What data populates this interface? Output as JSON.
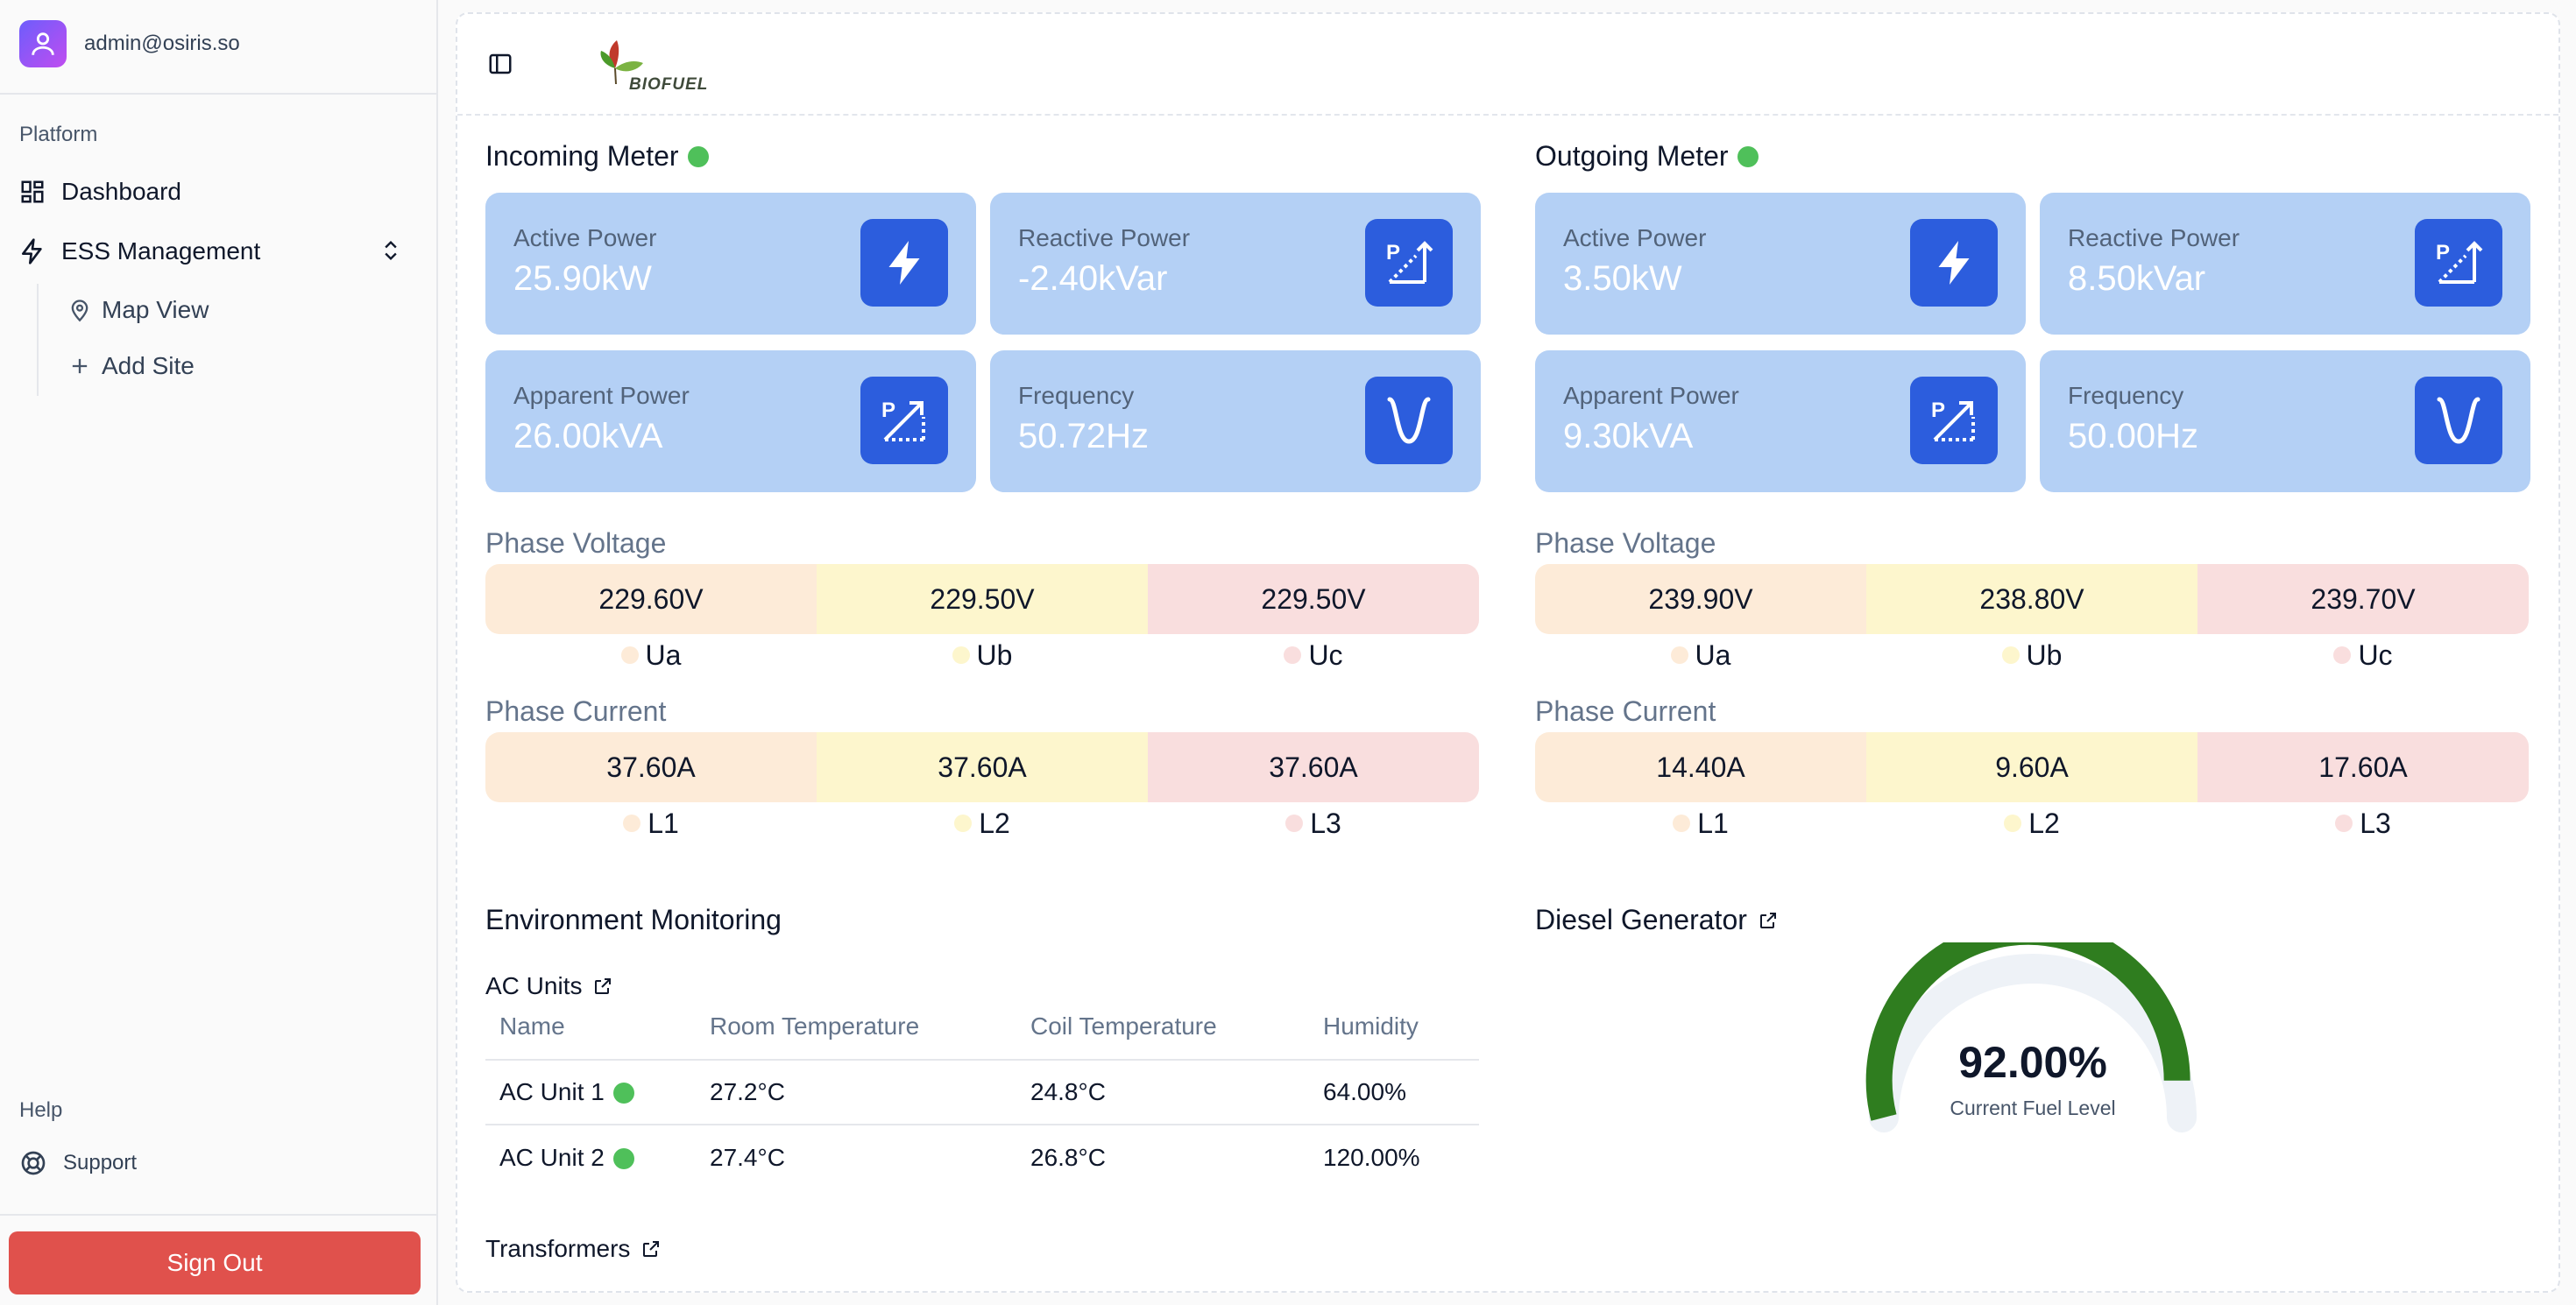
{
  "user": {
    "email": "admin@osiris.so"
  },
  "sidebar": {
    "platform_label": "Platform",
    "items": [
      {
        "label": "Dashboard",
        "icon": "dashboard-icon"
      },
      {
        "label": "ESS Management",
        "icon": "zap-icon"
      }
    ],
    "sub_items": [
      {
        "label": "Map View",
        "icon": "map-pin-icon"
      },
      {
        "label": "Add Site",
        "icon": "plus-icon"
      }
    ],
    "help_label": "Help",
    "support_label": "Support",
    "signout_label": "Sign Out"
  },
  "header": {
    "logo_text": "BIOFUEL"
  },
  "incoming": {
    "title": "Incoming Meter",
    "status_color": "#4fc05a",
    "cards": [
      {
        "label": "Active Power",
        "value": "25.90kW",
        "icon": "lightning-icon"
      },
      {
        "label": "Reactive Power",
        "value": "-2.40kVar",
        "icon": "reactive-power-icon"
      },
      {
        "label": "Apparent Power",
        "value": "26.00kVA",
        "icon": "apparent-power-icon"
      },
      {
        "label": "Frequency",
        "value": "50.72Hz",
        "icon": "frequency-icon"
      }
    ],
    "phase_voltage_title": "Phase Voltage",
    "phase_voltage": [
      {
        "value": "229.60V",
        "label": "Ua"
      },
      {
        "value": "229.50V",
        "label": "Ub"
      },
      {
        "value": "229.50V",
        "label": "Uc"
      }
    ],
    "phase_current_title": "Phase Current",
    "phase_current": [
      {
        "value": "37.60A",
        "label": "L1"
      },
      {
        "value": "37.60A",
        "label": "L2"
      },
      {
        "value": "37.60A",
        "label": "L3"
      }
    ]
  },
  "outgoing": {
    "title": "Outgoing Meter",
    "status_color": "#4fc05a",
    "cards": [
      {
        "label": "Active Power",
        "value": "3.50kW",
        "icon": "lightning-icon"
      },
      {
        "label": "Reactive Power",
        "value": "8.50kVar",
        "icon": "reactive-power-icon"
      },
      {
        "label": "Apparent Power",
        "value": "9.30kVA",
        "icon": "apparent-power-icon"
      },
      {
        "label": "Frequency",
        "value": "50.00Hz",
        "icon": "frequency-icon"
      }
    ],
    "phase_voltage_title": "Phase Voltage",
    "phase_voltage": [
      {
        "value": "239.90V",
        "label": "Ua"
      },
      {
        "value": "238.80V",
        "label": "Ub"
      },
      {
        "value": "239.70V",
        "label": "Uc"
      }
    ],
    "phase_current_title": "Phase Current",
    "phase_current": [
      {
        "value": "14.40A",
        "label": "L1"
      },
      {
        "value": "9.60A",
        "label": "L2"
      },
      {
        "value": "17.60A",
        "label": "L3"
      }
    ]
  },
  "environment": {
    "title": "Environment Monitoring",
    "ac_units_title": "AC Units",
    "columns": [
      "Name",
      "Room Temperature",
      "Coil Temperature",
      "Humidity"
    ],
    "rows": [
      {
        "name": "AC Unit 1",
        "room": "27.2°C",
        "coil": "24.8°C",
        "humidity": "64.00%"
      },
      {
        "name": "AC Unit 2",
        "room": "27.4°C",
        "coil": "26.8°C",
        "humidity": "120.00%"
      }
    ],
    "transformers_title": "Transformers"
  },
  "diesel": {
    "title": "Diesel Generator",
    "fuel_value": "92.00%",
    "fuel_fraction": 0.92,
    "fuel_label": "Current Fuel Level",
    "gauge_color": "#2f7d1f",
    "gauge_track_color": "#eef2f7"
  },
  "colors": {
    "card_bg": "#b4d0f5",
    "icon_bg": "#2c5ddd",
    "phase_1": "#fdebd8",
    "phase_2": "#fdf6cd",
    "phase_3": "#f9dede",
    "signout_bg": "#e0514c"
  }
}
